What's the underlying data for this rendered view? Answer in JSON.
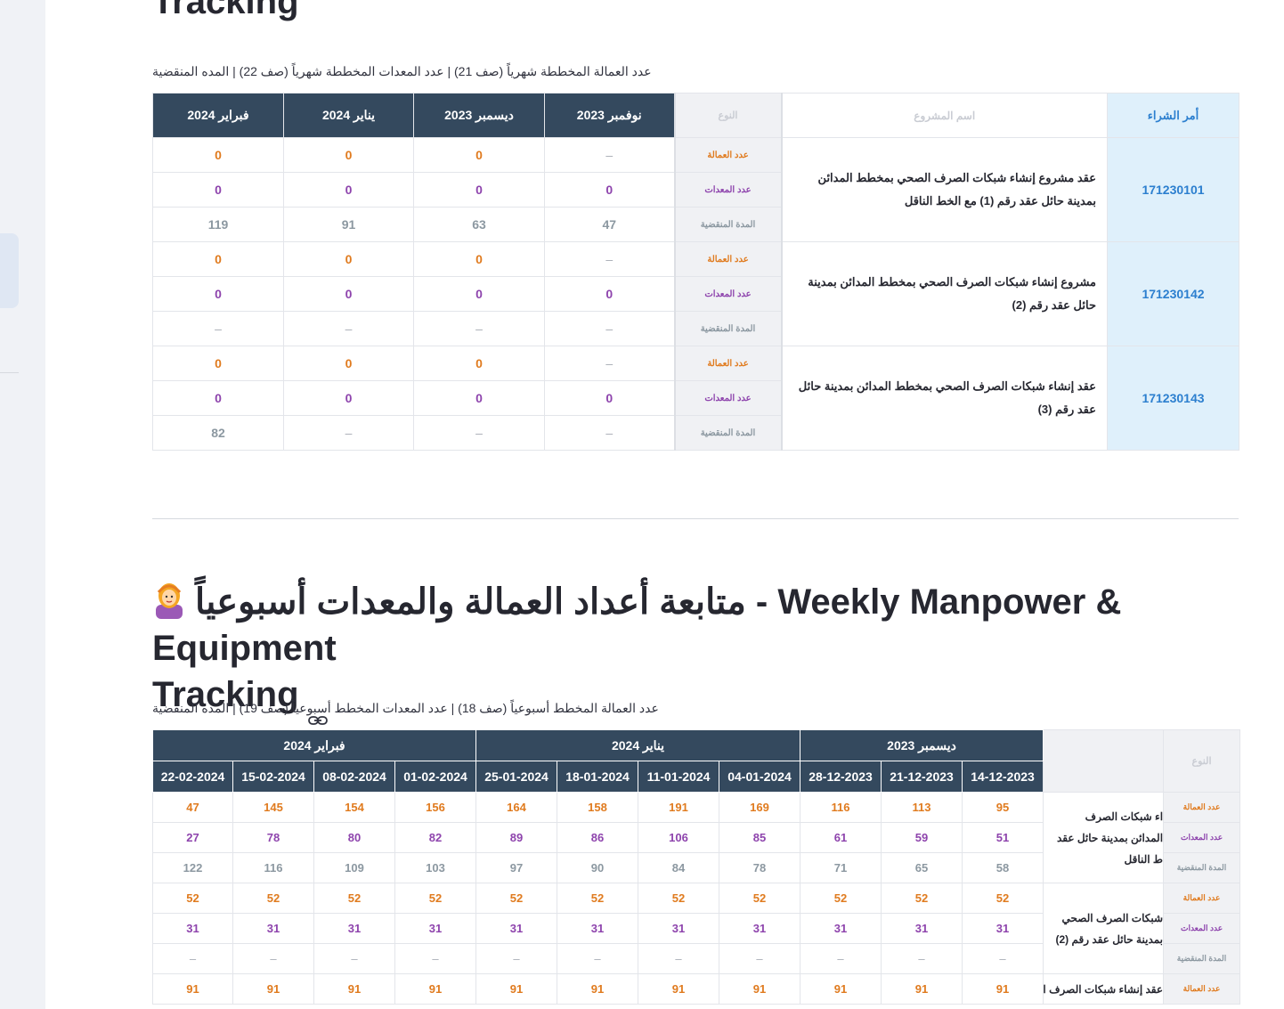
{
  "monthly": {
    "title_line2": "Tracking",
    "caption": "عدد العمالة المخططة شهرياً (صف 21) | عدد المعدات المخططة شهرياً (صف 22) | المده المنقضية",
    "headers": {
      "po": "أمر الشراء",
      "project": "اسم المشروع",
      "kind": "النوع",
      "months": [
        "نوفمبر 2023",
        "ديسمبر 2023",
        "يناير 2024",
        "فبراير 2024"
      ]
    },
    "rows": [
      {
        "po": "171230101",
        "project": "عقد مشروع إنشاء شبكات الصرف الصحي بمخطط المدائن بمدينة حائل عقد رقم (1) مع الخط الناقل",
        "labor": [
          "–",
          "0",
          "0",
          "0"
        ],
        "equip": [
          "0",
          "0",
          "0",
          "0"
        ],
        "elapsed": [
          "47",
          "63",
          "91",
          "119"
        ]
      },
      {
        "po": "171230142",
        "project": "مشروع إنشاء شبكات الصرف الصحي بمخطط المدائن بمدينة حائل عقد رقم (2)",
        "labor": [
          "–",
          "0",
          "0",
          "0"
        ],
        "equip": [
          "0",
          "0",
          "0",
          "0"
        ],
        "elapsed": [
          "–",
          "–",
          "–",
          "–"
        ]
      },
      {
        "po": "171230143",
        "project": "عقد إنشاء شبكات الصرف الصحي بمخطط المدائن بمدينة حائل عقد رقم (3)",
        "labor": [
          "–",
          "0",
          "0",
          "0"
        ],
        "equip": [
          "0",
          "0",
          "0",
          "0"
        ],
        "elapsed": [
          "–",
          "–",
          "–",
          "82"
        ]
      }
    ],
    "kinds": {
      "labor": "عدد العمالة",
      "equip": "عدد المعدات",
      "elapsed": "المدة المنقضية"
    }
  },
  "weekly": {
    "title_en": "Weekly Manpower & Equipment",
    "title_ar": "متابعة أعداد العمالة والمعدات أسبوعياً",
    "title_sep": "-",
    "title_line2": "Tracking",
    "caption": "عدد العمالة المخطط أسبوعياً (صف 18) | عدد المعدات المخطط أسبوعياً (صف 19) | المده المنقضية",
    "kind_header": "النوع",
    "month_groups": [
      {
        "label": "ديسمبر 2023",
        "span": 3
      },
      {
        "label": "يناير 2024",
        "span": 4
      },
      {
        "label": "فبراير 2024",
        "span": 4
      }
    ],
    "weeks": [
      "14-12-2023",
      "21-12-2023",
      "28-12-2023",
      "04-01-2024",
      "11-01-2024",
      "18-01-2024",
      "25-01-2024",
      "01-02-2024",
      "08-02-2024",
      "15-02-2024",
      "22-02-2024"
    ],
    "rows": [
      {
        "project_lines": [
          "اء شبكات الصرف",
          "المدائن بمدينة حائل عقد",
          "ط الناقل"
        ],
        "labor": [
          "95",
          "113",
          "116",
          "169",
          "191",
          "158",
          "164",
          "156",
          "154",
          "145",
          "47"
        ],
        "equip": [
          "51",
          "59",
          "61",
          "85",
          "106",
          "86",
          "89",
          "82",
          "80",
          "78",
          "27"
        ],
        "elapsed": [
          "58",
          "65",
          "71",
          "78",
          "84",
          "90",
          "97",
          "103",
          "109",
          "116",
          "122"
        ]
      },
      {
        "project_lines": [
          "شبكات الصرف الصحي",
          "بمدينة حائل عقد رقم (2)"
        ],
        "labor": [
          "52",
          "52",
          "52",
          "52",
          "52",
          "52",
          "52",
          "52",
          "52",
          "52",
          "52"
        ],
        "equip": [
          "31",
          "31",
          "31",
          "31",
          "31",
          "31",
          "31",
          "31",
          "31",
          "31",
          "31"
        ],
        "elapsed": [
          "–",
          "–",
          "–",
          "–",
          "–",
          "–",
          "–",
          "–",
          "–",
          "–",
          "–"
        ]
      },
      {
        "project_lines": [
          "عقد إنشاء شبكات الصرف الصحي بمخطط"
        ],
        "labor": [
          "91",
          "91",
          "91",
          "91",
          "91",
          "91",
          "91",
          "91",
          "91",
          "91",
          "91"
        ]
      }
    ]
  },
  "colors": {
    "header_bg": "#34495e",
    "labor": "#e07b1f",
    "equip": "#8e44ad",
    "elapsed": "#8c98a1",
    "po_bg": "#dff0fb",
    "po_text": "#2c7fcf"
  },
  "icons": {
    "anchor": "link-icon",
    "person": "person-with-headscarf-icon"
  }
}
